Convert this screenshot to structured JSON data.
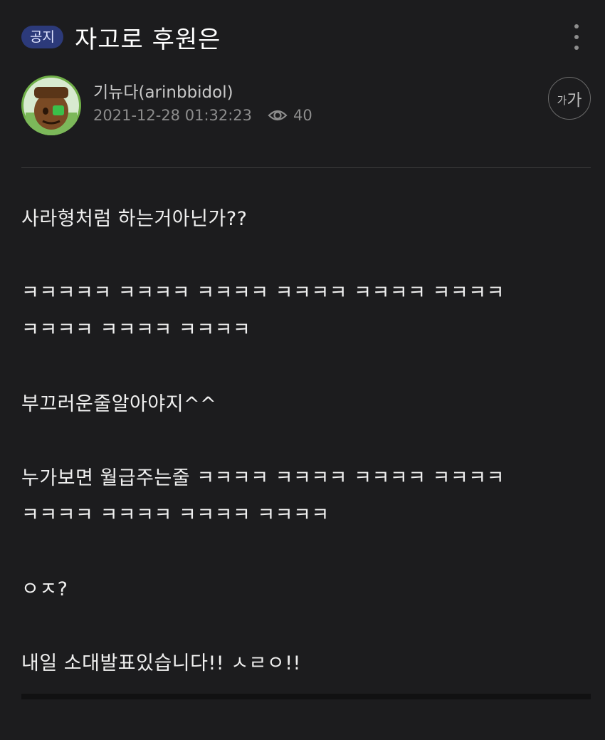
{
  "post": {
    "badge": "공지",
    "title": "자고로 후원은"
  },
  "author": {
    "name": "기뉴다(arinbbidol)",
    "datetime": "2021-12-28 01:32:23",
    "views": "40"
  },
  "font_size_button": {
    "small": "가",
    "large": "가"
  },
  "body": {
    "p1": "사라형처럼 하는거아닌가??",
    "p2a": "ㅋㅋㅋㅋㅋ ㅋㅋㅋㅋ ㅋㅋㅋㅋ ㅋㅋㅋㅋ ㅋㅋㅋㅋ ㅋㅋㅋㅋ",
    "p2b": "ㅋㅋㅋㅋ ㅋㅋㅋㅋ ㅋㅋㅋㅋ",
    "p3": "부끄러운줄알아야지^^",
    "p4a": "누가보면 월급주는줄 ㅋㅋㅋㅋ ㅋㅋㅋㅋ ㅋㅋㅋㅋ ㅋㅋㅋㅋ",
    "p4b": "ㅋㅋㅋㅋ ㅋㅋㅋㅋ ㅋㅋㅋㅋ ㅋㅋㅋㅋ",
    "p5": "ㅇㅈ?",
    "p6": "내일 소대발표있습니다!! ㅅㄹㅇ!!"
  },
  "icons": {
    "more": "more-vertical-icon",
    "views": "eye-icon",
    "font_size": "font-size-icon"
  },
  "colors": {
    "background": "#1c1c1e",
    "badge_bg": "#2c3a7a",
    "text": "#f0f0f0",
    "meta": "#8d8d8d"
  }
}
